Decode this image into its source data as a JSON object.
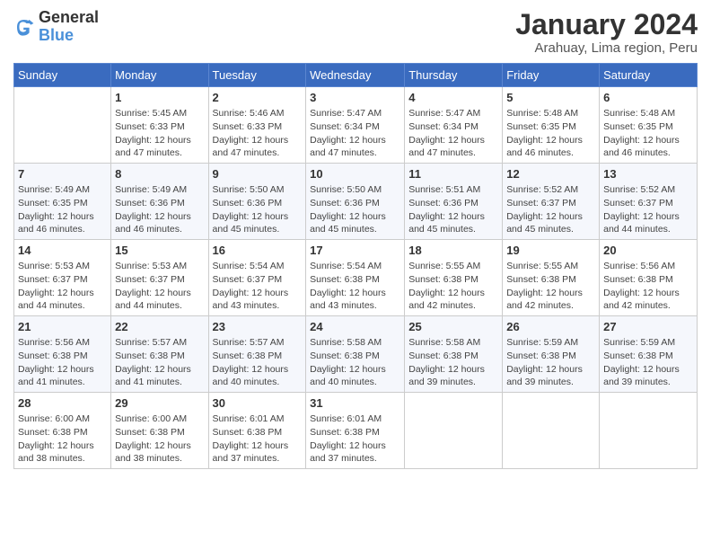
{
  "header": {
    "logo_line1": "General",
    "logo_line2": "Blue",
    "month_title": "January 2024",
    "subtitle": "Arahuay, Lima region, Peru"
  },
  "days_of_week": [
    "Sunday",
    "Monday",
    "Tuesday",
    "Wednesday",
    "Thursday",
    "Friday",
    "Saturday"
  ],
  "weeks": [
    [
      {
        "num": "",
        "info": ""
      },
      {
        "num": "1",
        "info": "Sunrise: 5:45 AM\nSunset: 6:33 PM\nDaylight: 12 hours\nand 47 minutes."
      },
      {
        "num": "2",
        "info": "Sunrise: 5:46 AM\nSunset: 6:33 PM\nDaylight: 12 hours\nand 47 minutes."
      },
      {
        "num": "3",
        "info": "Sunrise: 5:47 AM\nSunset: 6:34 PM\nDaylight: 12 hours\nand 47 minutes."
      },
      {
        "num": "4",
        "info": "Sunrise: 5:47 AM\nSunset: 6:34 PM\nDaylight: 12 hours\nand 47 minutes."
      },
      {
        "num": "5",
        "info": "Sunrise: 5:48 AM\nSunset: 6:35 PM\nDaylight: 12 hours\nand 46 minutes."
      },
      {
        "num": "6",
        "info": "Sunrise: 5:48 AM\nSunset: 6:35 PM\nDaylight: 12 hours\nand 46 minutes."
      }
    ],
    [
      {
        "num": "7",
        "info": "Sunrise: 5:49 AM\nSunset: 6:35 PM\nDaylight: 12 hours\nand 46 minutes."
      },
      {
        "num": "8",
        "info": "Sunrise: 5:49 AM\nSunset: 6:36 PM\nDaylight: 12 hours\nand 46 minutes."
      },
      {
        "num": "9",
        "info": "Sunrise: 5:50 AM\nSunset: 6:36 PM\nDaylight: 12 hours\nand 45 minutes."
      },
      {
        "num": "10",
        "info": "Sunrise: 5:50 AM\nSunset: 6:36 PM\nDaylight: 12 hours\nand 45 minutes."
      },
      {
        "num": "11",
        "info": "Sunrise: 5:51 AM\nSunset: 6:36 PM\nDaylight: 12 hours\nand 45 minutes."
      },
      {
        "num": "12",
        "info": "Sunrise: 5:52 AM\nSunset: 6:37 PM\nDaylight: 12 hours\nand 45 minutes."
      },
      {
        "num": "13",
        "info": "Sunrise: 5:52 AM\nSunset: 6:37 PM\nDaylight: 12 hours\nand 44 minutes."
      }
    ],
    [
      {
        "num": "14",
        "info": "Sunrise: 5:53 AM\nSunset: 6:37 PM\nDaylight: 12 hours\nand 44 minutes."
      },
      {
        "num": "15",
        "info": "Sunrise: 5:53 AM\nSunset: 6:37 PM\nDaylight: 12 hours\nand 44 minutes."
      },
      {
        "num": "16",
        "info": "Sunrise: 5:54 AM\nSunset: 6:37 PM\nDaylight: 12 hours\nand 43 minutes."
      },
      {
        "num": "17",
        "info": "Sunrise: 5:54 AM\nSunset: 6:38 PM\nDaylight: 12 hours\nand 43 minutes."
      },
      {
        "num": "18",
        "info": "Sunrise: 5:55 AM\nSunset: 6:38 PM\nDaylight: 12 hours\nand 42 minutes."
      },
      {
        "num": "19",
        "info": "Sunrise: 5:55 AM\nSunset: 6:38 PM\nDaylight: 12 hours\nand 42 minutes."
      },
      {
        "num": "20",
        "info": "Sunrise: 5:56 AM\nSunset: 6:38 PM\nDaylight: 12 hours\nand 42 minutes."
      }
    ],
    [
      {
        "num": "21",
        "info": "Sunrise: 5:56 AM\nSunset: 6:38 PM\nDaylight: 12 hours\nand 41 minutes."
      },
      {
        "num": "22",
        "info": "Sunrise: 5:57 AM\nSunset: 6:38 PM\nDaylight: 12 hours\nand 41 minutes."
      },
      {
        "num": "23",
        "info": "Sunrise: 5:57 AM\nSunset: 6:38 PM\nDaylight: 12 hours\nand 40 minutes."
      },
      {
        "num": "24",
        "info": "Sunrise: 5:58 AM\nSunset: 6:38 PM\nDaylight: 12 hours\nand 40 minutes."
      },
      {
        "num": "25",
        "info": "Sunrise: 5:58 AM\nSunset: 6:38 PM\nDaylight: 12 hours\nand 39 minutes."
      },
      {
        "num": "26",
        "info": "Sunrise: 5:59 AM\nSunset: 6:38 PM\nDaylight: 12 hours\nand 39 minutes."
      },
      {
        "num": "27",
        "info": "Sunrise: 5:59 AM\nSunset: 6:38 PM\nDaylight: 12 hours\nand 39 minutes."
      }
    ],
    [
      {
        "num": "28",
        "info": "Sunrise: 6:00 AM\nSunset: 6:38 PM\nDaylight: 12 hours\nand 38 minutes."
      },
      {
        "num": "29",
        "info": "Sunrise: 6:00 AM\nSunset: 6:38 PM\nDaylight: 12 hours\nand 38 minutes."
      },
      {
        "num": "30",
        "info": "Sunrise: 6:01 AM\nSunset: 6:38 PM\nDaylight: 12 hours\nand 37 minutes."
      },
      {
        "num": "31",
        "info": "Sunrise: 6:01 AM\nSunset: 6:38 PM\nDaylight: 12 hours\nand 37 minutes."
      },
      {
        "num": "",
        "info": ""
      },
      {
        "num": "",
        "info": ""
      },
      {
        "num": "",
        "info": ""
      }
    ]
  ]
}
